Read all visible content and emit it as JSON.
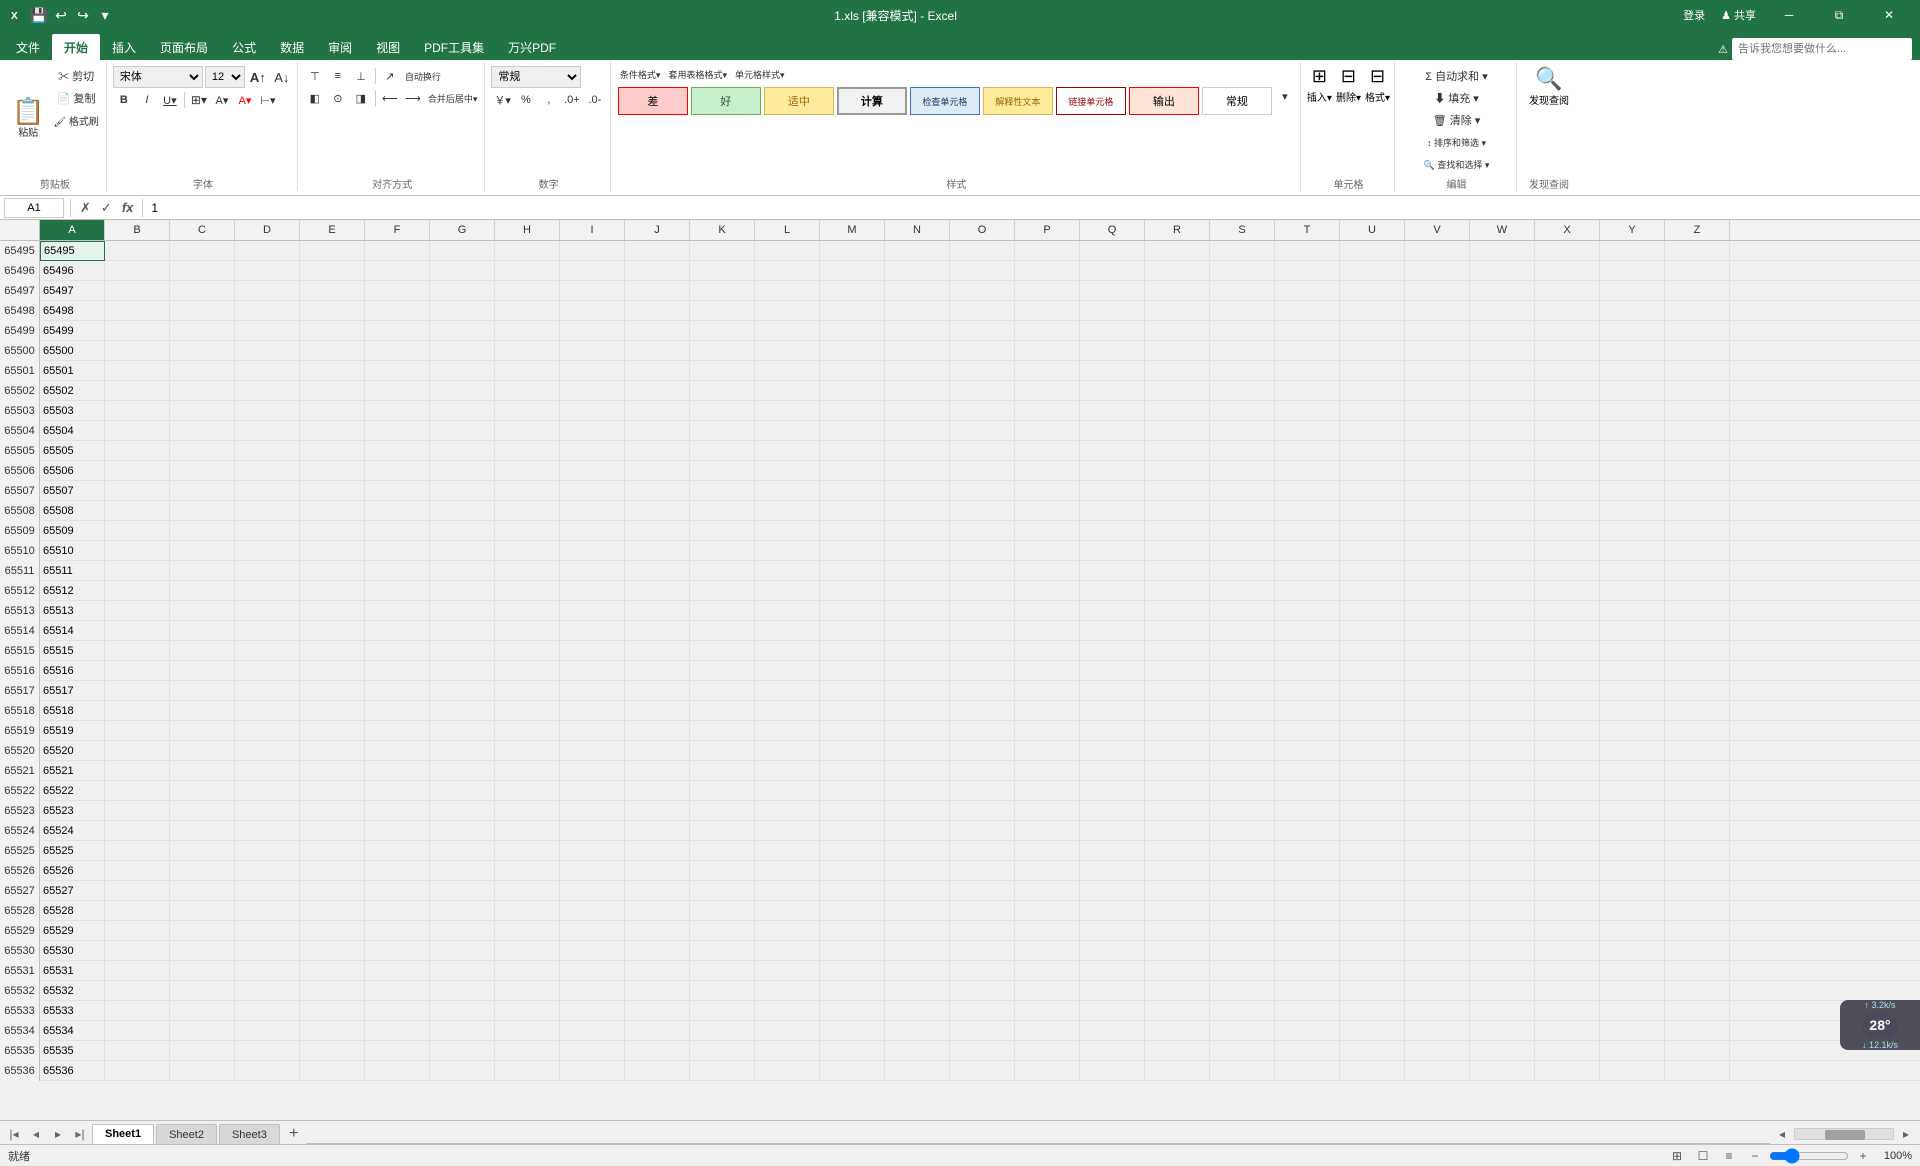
{
  "titleBar": {
    "fileName": "1.xls [兼容模式] - Excel",
    "quickAccess": [
      "save",
      "undo",
      "redo",
      "customize"
    ],
    "windowControls": [
      "minimize",
      "restore",
      "close"
    ]
  },
  "ribbon": {
    "tabs": [
      "文件",
      "开始",
      "插入",
      "页面布局",
      "公式",
      "数据",
      "审阅",
      "视图",
      "PDF工具集",
      "万兴PDF"
    ],
    "activeTab": "开始",
    "searchPlaceholder": "告诉我您想要做什么...",
    "groups": {
      "clipboard": {
        "label": "剪贴板",
        "buttons": [
          "粘贴",
          "剪切",
          "复制",
          "格式刷"
        ]
      },
      "font": {
        "label": "字体",
        "fontName": "宋体",
        "fontSize": "12",
        "bold": "B",
        "italic": "I",
        "underline": "U"
      },
      "alignment": {
        "label": "对齐方式",
        "autoWrap": "自动换行",
        "merge": "合并后居中"
      },
      "number": {
        "label": "数字",
        "format": "常规"
      },
      "styles": {
        "label": "样式",
        "conditional": "条件格式",
        "tableFormat": "套用表格格式",
        "cellStyle": "单元格样式",
        "cells": [
          {
            "label": "差",
            "style": "diff"
          },
          {
            "label": "好",
            "style": "good"
          },
          {
            "label": "适中",
            "style": "medium"
          },
          {
            "label": "计算",
            "style": "calc"
          },
          {
            "label": "检查单元格",
            "style": "check"
          },
          {
            "label": "解释性文本",
            "style": "explain"
          },
          {
            "label": "链接单元格",
            "style": "link"
          },
          {
            "label": "输出",
            "style": "output"
          },
          {
            "label": "常规",
            "style": "normal"
          }
        ]
      },
      "cells": {
        "label": "单元格",
        "insert": "插入",
        "delete": "删除",
        "format": "格式"
      },
      "editing": {
        "label": "编辑",
        "autoSum": "自动求和",
        "fill": "填充",
        "clear": "清除",
        "sortFilter": "排序和筛选",
        "findSelect": "查找和选择"
      },
      "review": {
        "label": "发现查阅",
        "button": "发现查阅"
      }
    }
  },
  "formulaBar": {
    "cellRef": "A1",
    "formula": "1",
    "icons": [
      "✓",
      "✗",
      "fx"
    ]
  },
  "spreadsheet": {
    "columns": [
      "A",
      "B",
      "C",
      "D",
      "E",
      "F",
      "G",
      "H",
      "I",
      "J",
      "K",
      "L",
      "M",
      "N",
      "O",
      "P",
      "Q",
      "R",
      "S",
      "T",
      "U",
      "V",
      "W",
      "X",
      "Y",
      "Z"
    ],
    "activeCell": "A1",
    "startRow": 65495,
    "rows": [
      {
        "num": 65495,
        "a": "65495"
      },
      {
        "num": 65496,
        "a": "65496"
      },
      {
        "num": 65497,
        "a": "65497"
      },
      {
        "num": 65498,
        "a": "65498"
      },
      {
        "num": 65499,
        "a": "65499"
      },
      {
        "num": 65500,
        "a": "65500"
      },
      {
        "num": 65501,
        "a": "65501"
      },
      {
        "num": 65502,
        "a": "65502"
      },
      {
        "num": 65503,
        "a": "65503"
      },
      {
        "num": 65504,
        "a": "65504"
      },
      {
        "num": 65505,
        "a": "65505"
      },
      {
        "num": 65506,
        "a": "65506"
      },
      {
        "num": 65507,
        "a": "65507"
      },
      {
        "num": 65508,
        "a": "65508"
      },
      {
        "num": 65509,
        "a": "65509"
      },
      {
        "num": 65510,
        "a": "65510"
      },
      {
        "num": 65511,
        "a": "65511"
      },
      {
        "num": 65512,
        "a": "65512"
      },
      {
        "num": 65513,
        "a": "65513"
      },
      {
        "num": 65514,
        "a": "65514"
      },
      {
        "num": 65515,
        "a": "65515"
      },
      {
        "num": 65516,
        "a": "65516"
      },
      {
        "num": 65517,
        "a": "65517"
      },
      {
        "num": 65518,
        "a": "65518"
      },
      {
        "num": 65519,
        "a": "65519"
      },
      {
        "num": 65520,
        "a": "65520"
      },
      {
        "num": 65521,
        "a": "65521"
      },
      {
        "num": 65522,
        "a": "65522"
      },
      {
        "num": 65523,
        "a": "65523"
      },
      {
        "num": 65524,
        "a": "65524"
      },
      {
        "num": 65525,
        "a": "65525"
      },
      {
        "num": 65526,
        "a": "65526"
      },
      {
        "num": 65527,
        "a": "65527"
      },
      {
        "num": 65528,
        "a": "65528"
      },
      {
        "num": 65529,
        "a": "65529"
      },
      {
        "num": 65530,
        "a": "65530"
      },
      {
        "num": 65531,
        "a": "65531"
      },
      {
        "num": 65532,
        "a": "65532"
      },
      {
        "num": 65533,
        "a": "65533"
      },
      {
        "num": 65534,
        "a": "65534"
      },
      {
        "num": 65535,
        "a": "65535"
      },
      {
        "num": 65536,
        "a": "65536"
      }
    ]
  },
  "sheetTabs": {
    "sheets": [
      "Sheet1",
      "Sheet2",
      "Sheet3"
    ],
    "activeSheet": "Sheet1"
  },
  "statusBar": {
    "text": "就绪",
    "zoomLevel": "100%",
    "scrollPosition": ""
  },
  "networkWidget": {
    "upload": "3.2k/s",
    "download": "12.1k/s",
    "temperature": "28"
  }
}
